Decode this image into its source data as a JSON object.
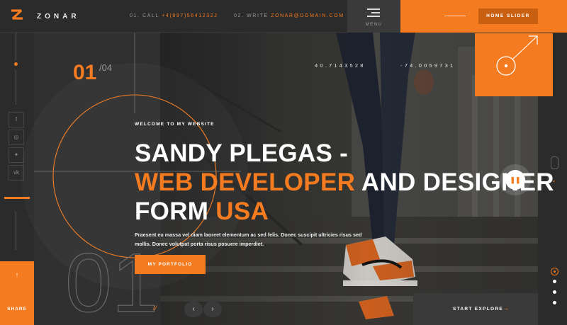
{
  "brand": {
    "name": "ZONAR"
  },
  "contact": {
    "call_label": "01. CALL",
    "call_value": "+4(897)56412322",
    "write_label": "02. WRITE",
    "write_value": "ZONAR@DOMAIN.COM"
  },
  "menu": {
    "label": "MENU"
  },
  "header": {
    "home_slider_label": "HOME SLIDER"
  },
  "coordinates": {
    "lat": "40.7143528",
    "lng": "-74.0059731"
  },
  "slider": {
    "current": "01",
    "total": "/04",
    "big_number": "01"
  },
  "hero": {
    "welcome": "WELCOME TO MY WEBSITE",
    "line1": "SANDY PLEGAS -",
    "line2_accent": "WEB DEVELOPER",
    "line2_rest": " AND DESIGNER",
    "line3_rest": "FORM ",
    "line3_accent": "USA",
    "description": "Praesent eu massa vel diam laoreet elementum ac sed felis. Donec suscipit ultricies risus sed mollis. Donec volutpat porta risus posuere imperdiet.",
    "portfolio_button": "MY PORTFOLIO"
  },
  "social": [
    {
      "icon": "facebook-icon",
      "glyph": "f"
    },
    {
      "icon": "instagram-icon",
      "glyph": "◎"
    },
    {
      "icon": "twitter-icon",
      "glyph": "✦"
    },
    {
      "icon": "vk-icon",
      "glyph": "vk"
    }
  ],
  "footer": {
    "share_label": "SHARE",
    "slash": "//",
    "prev_glyph": "‹",
    "next_glyph": "›",
    "start_explore_label": "START EXPLORE",
    "start_arrow": "→"
  },
  "colors": {
    "accent": "#f47b20",
    "dark": "#2b2b2b",
    "panel": "#303030"
  }
}
